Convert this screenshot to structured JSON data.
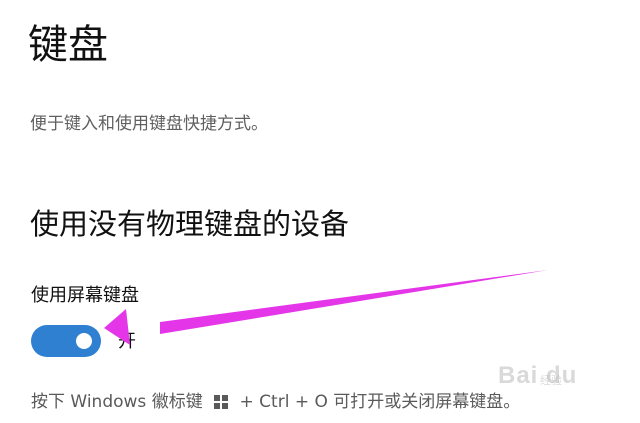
{
  "page": {
    "title": "键盘",
    "description": "便于键入和使用键盘快捷方式。"
  },
  "section": {
    "title": "使用没有物理键盘的设备"
  },
  "onscreen_keyboard": {
    "label": "使用屏幕键盘",
    "state": "开",
    "enabled": true,
    "accent_color": "#2f80d1"
  },
  "hint": {
    "prefix": "按下 Windows 徽标键",
    "icon": "windows-logo-icon",
    "suffix": "+ Ctrl + O 可打开或关闭屏幕键盘。"
  },
  "annotation": {
    "arrow_color": "#e436e8"
  },
  "watermark": {
    "brand": "Bai du",
    "sub": "经验"
  }
}
